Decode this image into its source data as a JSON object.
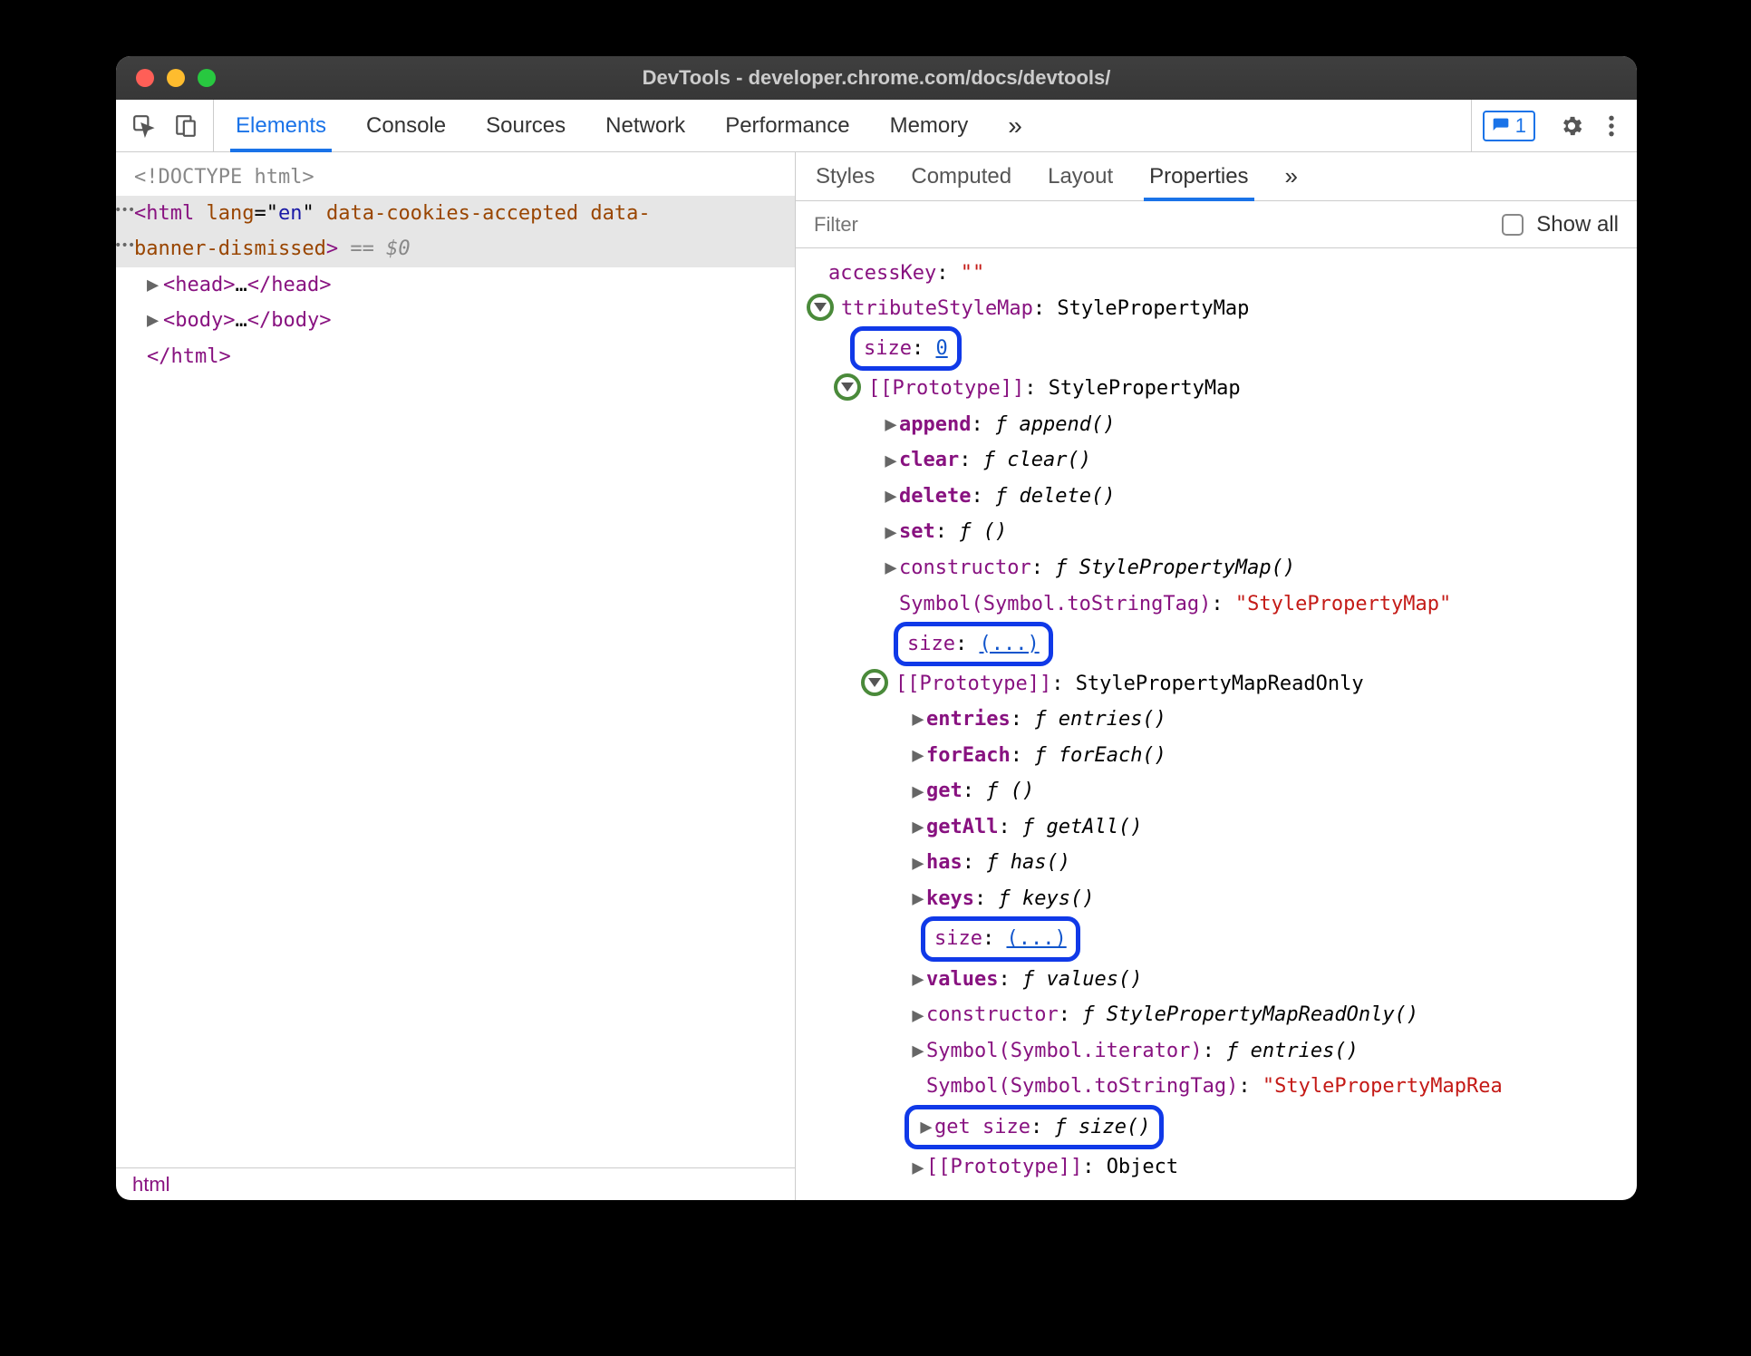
{
  "window": {
    "title": "DevTools - developer.chrome.com/docs/devtools/"
  },
  "toolbar": {
    "tabs": [
      "Elements",
      "Console",
      "Sources",
      "Network",
      "Performance",
      "Memory"
    ],
    "active": "Elements",
    "more_glyph": "»",
    "issues_count": "1"
  },
  "dom": {
    "doctype": "<!DOCTYPE html>",
    "html_open1": "<html lang=\"en\" data-cookies-accepted data-",
    "html_open2": "banner-dismissed>",
    "eq0": " == $0",
    "head": "<head>…</head>",
    "body": "<body>…</body>",
    "html_close": "</html>",
    "breadcrumb": "html"
  },
  "side": {
    "tabs": [
      "Styles",
      "Computed",
      "Layout",
      "Properties"
    ],
    "active": "Properties",
    "more_glyph": "»",
    "filter_placeholder": "Filter",
    "show_all": "Show all"
  },
  "props": {
    "accessKey": {
      "key": "accessKey",
      "val": "\"\""
    },
    "attributeStyleMap": {
      "key": "ttributeStyleMap",
      "val": "StylePropertyMap"
    },
    "size0": {
      "key": "size",
      "val": "0"
    },
    "proto1": {
      "key": "[[Prototype]]",
      "val": "StylePropertyMap"
    },
    "append": {
      "key": "append",
      "fn": "append()"
    },
    "clear": {
      "key": "clear",
      "fn": "clear()"
    },
    "delete": {
      "key": "delete",
      "fn": "delete()"
    },
    "set": {
      "key": "set",
      "fn": "()"
    },
    "constructor1": {
      "key": "constructor",
      "fn": "StylePropertyMap()"
    },
    "symTag1": {
      "key": "Symbol(Symbol.toStringTag)",
      "val": "\"StylePropertyMap\""
    },
    "sizeEllipsis1": {
      "key": "size",
      "val": "(...)"
    },
    "proto2": {
      "key": "[[Prototype]]",
      "val": "StylePropertyMapReadOnly"
    },
    "entries": {
      "key": "entries",
      "fn": "entries()"
    },
    "forEach": {
      "key": "forEach",
      "fn": "forEach()"
    },
    "get": {
      "key": "get",
      "fn": "()"
    },
    "getAll": {
      "key": "getAll",
      "fn": "getAll()"
    },
    "has": {
      "key": "has",
      "fn": "has()"
    },
    "keys": {
      "key": "keys",
      "fn": "keys()"
    },
    "sizeEllipsis2": {
      "key": "size",
      "val": "(...)"
    },
    "values": {
      "key": "values",
      "fn": "values()"
    },
    "constructor2": {
      "key": "constructor",
      "fn": "StylePropertyMapReadOnly()"
    },
    "symIter": {
      "key": "Symbol(Symbol.iterator)",
      "fn": "entries()"
    },
    "symTag2": {
      "key": "Symbol(Symbol.toStringTag)",
      "val": "\"StylePropertyMapRea"
    },
    "getSize": {
      "key": "get size",
      "fn": "size()"
    },
    "proto3": {
      "key": "[[Prototype]]",
      "val": "Object"
    }
  }
}
